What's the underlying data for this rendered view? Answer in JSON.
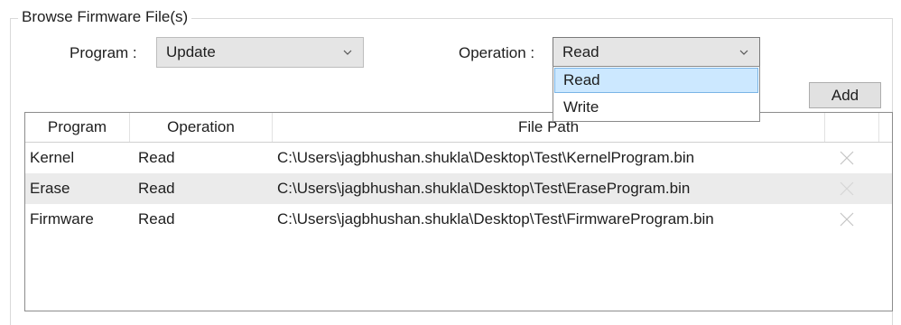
{
  "group": {
    "title": "Browse Firmware File(s)"
  },
  "program": {
    "label": "Program :",
    "selected": "Update"
  },
  "operation": {
    "label": "Operation :",
    "selected": "Read",
    "options": [
      "Read",
      "Write"
    ],
    "highlighted_option": "Read"
  },
  "add_button": {
    "label": "Add"
  },
  "table": {
    "headers": [
      "Program",
      "Operation",
      "File Path",
      ""
    ],
    "rows": [
      {
        "program": "Kernel",
        "operation": "Read",
        "path": "C:\\Users\\jagbhushan.shukla\\Desktop\\Test\\KernelProgram.bin"
      },
      {
        "program": "Erase",
        "operation": "Read",
        "path": "C:\\Users\\jagbhushan.shukla\\Desktop\\Test\\EraseProgram.bin"
      },
      {
        "program": "Firmware",
        "operation": "Read",
        "path": "C:\\Users\\jagbhushan.shukla\\Desktop\\Test\\FirmwareProgram.bin"
      }
    ],
    "row_action_icon": "delete-x-icon"
  },
  "colors": {
    "combo_bg": "#e5e5e5",
    "selection_bg": "#cce8ff",
    "selection_border": "#7ab5e6",
    "alt_row_bg": "#ebebeb"
  }
}
